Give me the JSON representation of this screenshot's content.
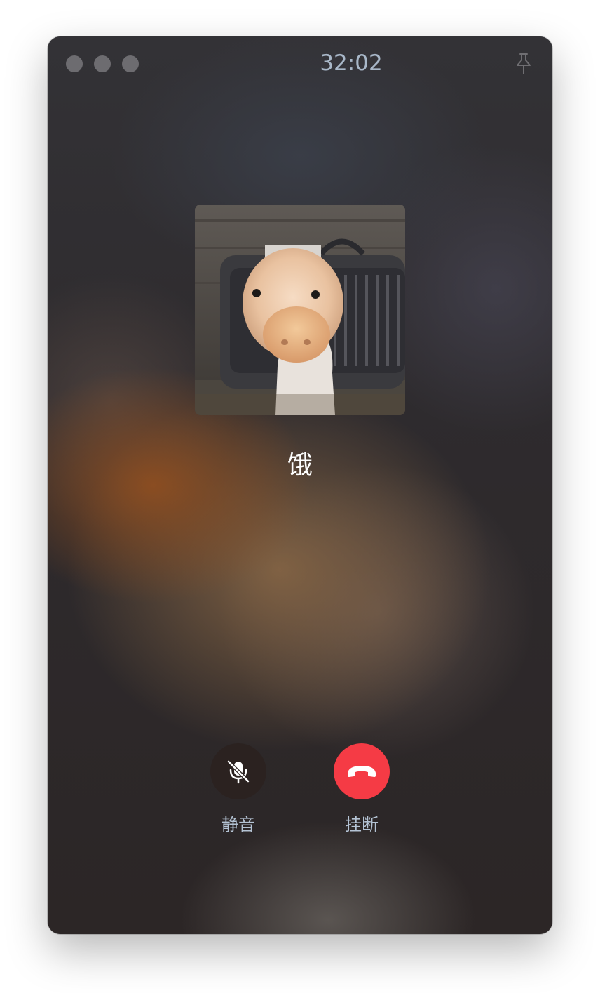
{
  "window": {
    "timer": "32:02"
  },
  "contact": {
    "name": "饿"
  },
  "controls": {
    "mute_label": "静音",
    "hangup_label": "挂断"
  },
  "icons": {
    "titlebar": [
      "window-dot-icon",
      "window-dot-icon",
      "window-dot-icon",
      "pin-icon"
    ],
    "mute": "microphone-off-icon",
    "hangup": "phone-hangup-icon"
  },
  "colors": {
    "hangup_accent": "#f53b45",
    "timer_text": "#a8b7c8",
    "label_text": "#b4c3d4"
  }
}
